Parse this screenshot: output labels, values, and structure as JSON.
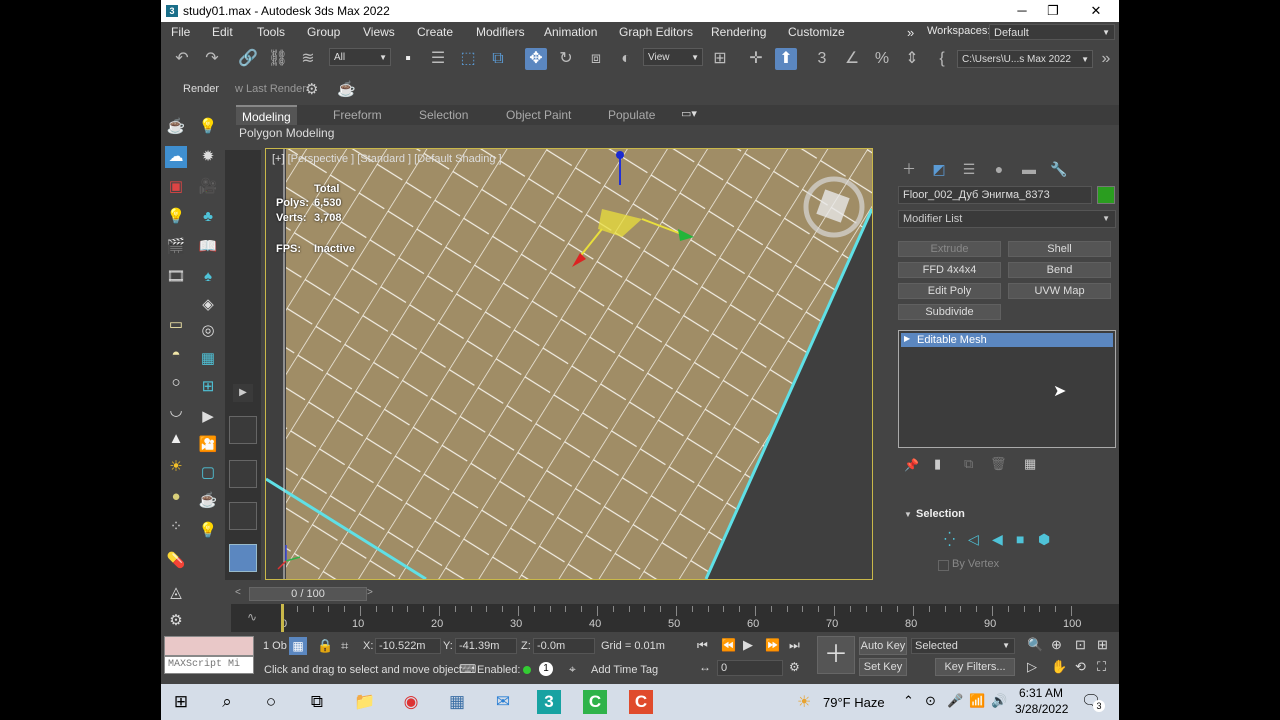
{
  "window": {
    "title": "study01.max - Autodesk 3ds Max 2022",
    "minimize": "─",
    "maximize": "❐",
    "close": "✕",
    "app_icon": "3"
  },
  "menu": [
    "File",
    "Edit",
    "Tools",
    "Group",
    "Views",
    "Create",
    "Modifiers",
    "Animation",
    "Graph Editors",
    "Rendering",
    "Customize"
  ],
  "workspaces": {
    "label": "Workspaces:",
    "value": "Default"
  },
  "toolbar": {
    "selection_filter": "All",
    "ref_coord": "View",
    "project_path": "C:\\Users\\U...s Max 2022"
  },
  "render_row": {
    "render_label": "Render",
    "last_render_label": "w Last Render"
  },
  "ribbon": {
    "tabs": [
      "Modeling",
      "Freeform",
      "Selection",
      "Object Paint",
      "Populate"
    ],
    "active_tab": "Modeling",
    "subpanel": "Polygon Modeling"
  },
  "viewport": {
    "label": "[+] [Perspective ] [Standard ] [Default Shading ]",
    "stats": {
      "total_label": "Total",
      "polys_label": "Polys:",
      "polys_value": "6,530",
      "verts_label": "Verts:",
      "verts_value": "3,708",
      "fps_label": "FPS:",
      "fps_value": "Inactive"
    }
  },
  "command_panel": {
    "object_name": "Floor_002_Дуб Энигма_8373",
    "object_color": "#2a9d1f",
    "modifier_list": "Modifier List",
    "modifier_buttons": [
      {
        "label": "Extrude",
        "enabled": false
      },
      {
        "label": "Shell",
        "enabled": true
      },
      {
        "label": "FFD 4x4x4",
        "enabled": true
      },
      {
        "label": "Bend",
        "enabled": true
      },
      {
        "label": "Edit Poly",
        "enabled": true
      },
      {
        "label": "UVW Map",
        "enabled": true
      },
      {
        "label": "Subdivide",
        "enabled": true
      }
    ],
    "stack_item": "Editable Mesh",
    "selection_rollout": "Selection",
    "by_vertex": "By Vertex"
  },
  "timeline": {
    "slider_label": "0 / 100",
    "ticks": [
      "0",
      "10",
      "20",
      "30",
      "40",
      "50",
      "60",
      "70",
      "80",
      "90",
      "100"
    ]
  },
  "status": {
    "selected_count": "1 Ob",
    "x_label": "X:",
    "x_value": "-10.522m",
    "y_label": "Y:",
    "y_value": "-41.39m",
    "z_label": "Z:",
    "z_value": "-0.0m",
    "grid": "Grid = 0.01m",
    "prompt": "Click and drag to select and move object",
    "enabled_label": "Enabled:",
    "add_time_tag": "Add Time Tag",
    "maxscript_placeholder": "MAXScript Mi",
    "frame_value": "0",
    "auto_key": "Auto Key",
    "set_key": "Set Key",
    "selected_dd": "Selected",
    "key_filters": "Key Filters..."
  },
  "taskbar": {
    "weather": "79°F  Haze",
    "time": "6:31 AM",
    "date": "3/28/2022",
    "notifications": "3"
  }
}
